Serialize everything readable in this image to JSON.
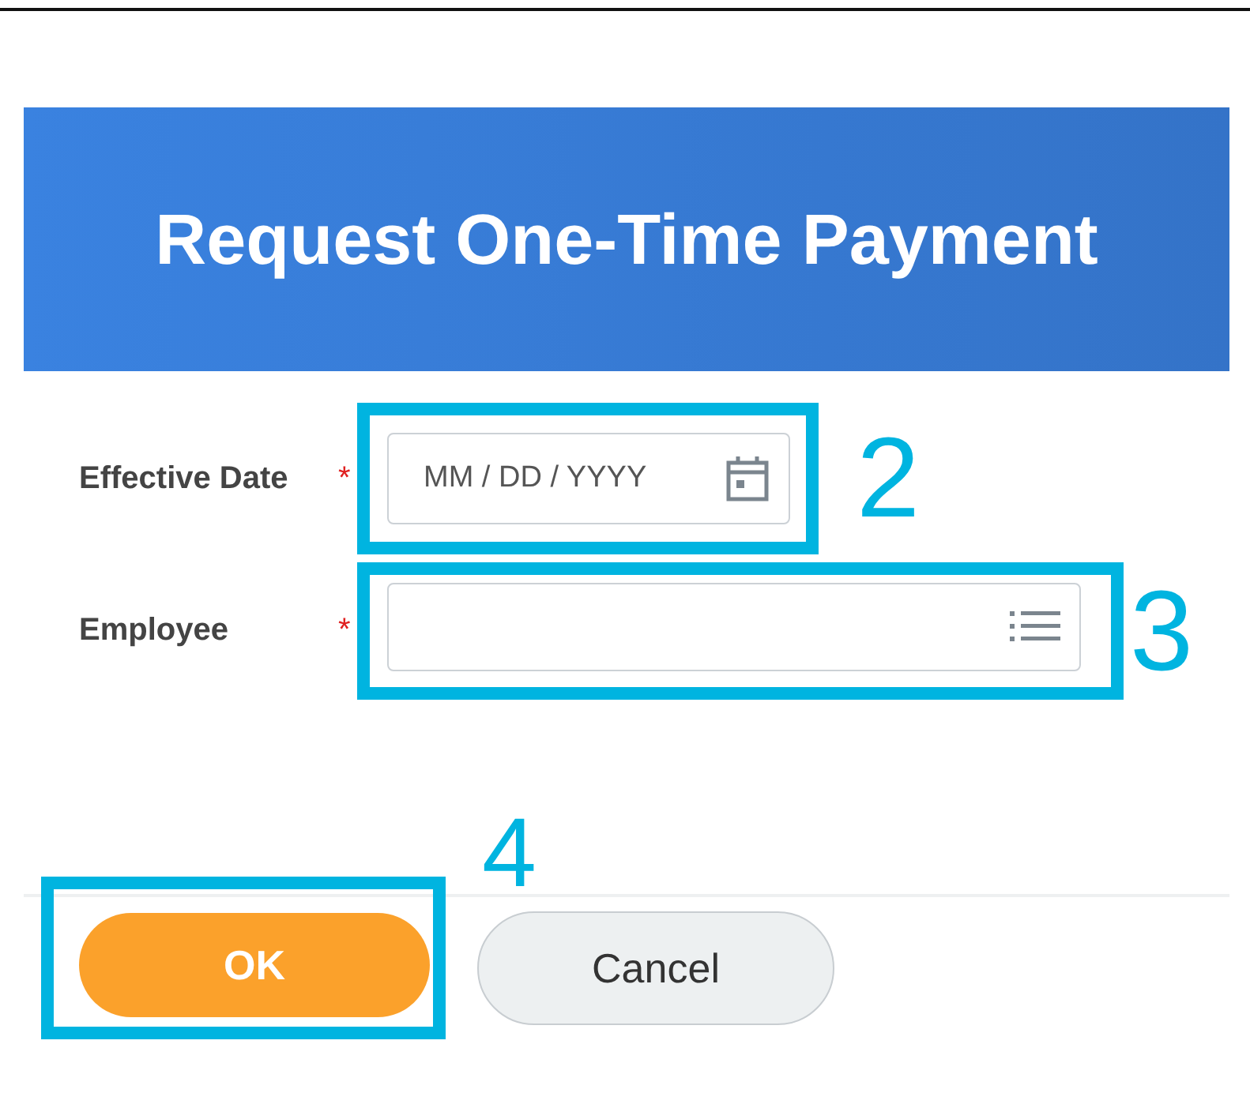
{
  "header": {
    "title": "Request One-Time Payment"
  },
  "fields": [
    {
      "kind": "date",
      "label": "Effective Date",
      "required_mark": "*",
      "placeholder": "MM / DD / YYYY",
      "callout": "2"
    },
    {
      "kind": "prompt",
      "label": "Employee",
      "required_mark": "*",
      "callout": "3"
    }
  ],
  "buttons": [
    {
      "kind": "primary",
      "label": "OK",
      "callout": "4"
    },
    {
      "kind": "secondary",
      "label": "Cancel"
    }
  ]
}
